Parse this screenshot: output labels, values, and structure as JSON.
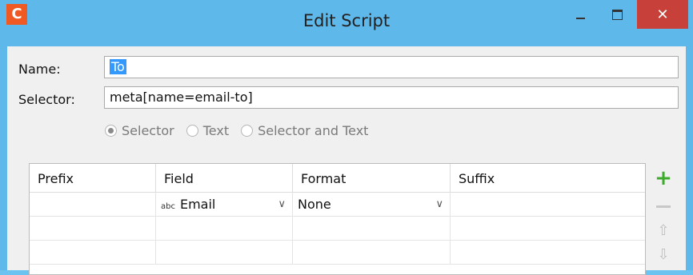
{
  "window": {
    "title": "Edit Script",
    "app_icon_letter": "C",
    "close_glyph": "✕"
  },
  "form": {
    "name_label": "Name:",
    "name_value": "To",
    "selector_label": "Selector:",
    "selector_value": "meta[name=email-to]"
  },
  "radios": [
    {
      "label": "Selector",
      "checked": true
    },
    {
      "label": "Text",
      "checked": false
    },
    {
      "label": "Selector and Text",
      "checked": false
    }
  ],
  "table": {
    "columns": [
      "Prefix",
      "Field",
      "Format",
      "Suffix"
    ],
    "rows": [
      {
        "prefix": "",
        "field_type": "abc",
        "field": "Email",
        "format": "None",
        "suffix": ""
      },
      {
        "prefix": "",
        "field_type": "",
        "field": "",
        "format": "",
        "suffix": ""
      },
      {
        "prefix": "",
        "field_type": "",
        "field": "",
        "format": "",
        "suffix": ""
      }
    ]
  },
  "side_buttons": [
    "add-icon",
    "remove-icon",
    "move-up-icon",
    "move-down-icon"
  ],
  "colors": {
    "titlebar": "#5fb8ea",
    "close": "#c7413a",
    "accent_add": "#3caa2a",
    "selection": "#3399ff"
  }
}
